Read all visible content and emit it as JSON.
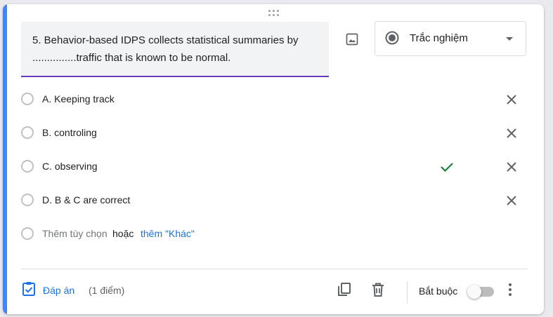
{
  "question": {
    "text": "5. Behavior-based IDPS collects statistical summaries by ...............traffic that is known to be normal."
  },
  "question_type": {
    "label": "Trắc nghiệm"
  },
  "options": [
    {
      "label": "A. Keeping track",
      "correct": false
    },
    {
      "label": "B. controling",
      "correct": false
    },
    {
      "label": "C. observing",
      "correct": true
    },
    {
      "label": "D. B & C are correct",
      "correct": false
    }
  ],
  "add_option": {
    "label": "Thêm tùy chọn",
    "or_text": "hoặc",
    "add_other_label": "thêm \"Khác\""
  },
  "footer": {
    "answer_key_label": "Đáp án",
    "points_label": "(1 điểm)",
    "required_label": "Bắt buộc",
    "required_on": false
  },
  "colors": {
    "accent": "#4285f4",
    "question_underline": "#673ab7",
    "link": "#1a73e8",
    "correct_check": "#188038"
  }
}
